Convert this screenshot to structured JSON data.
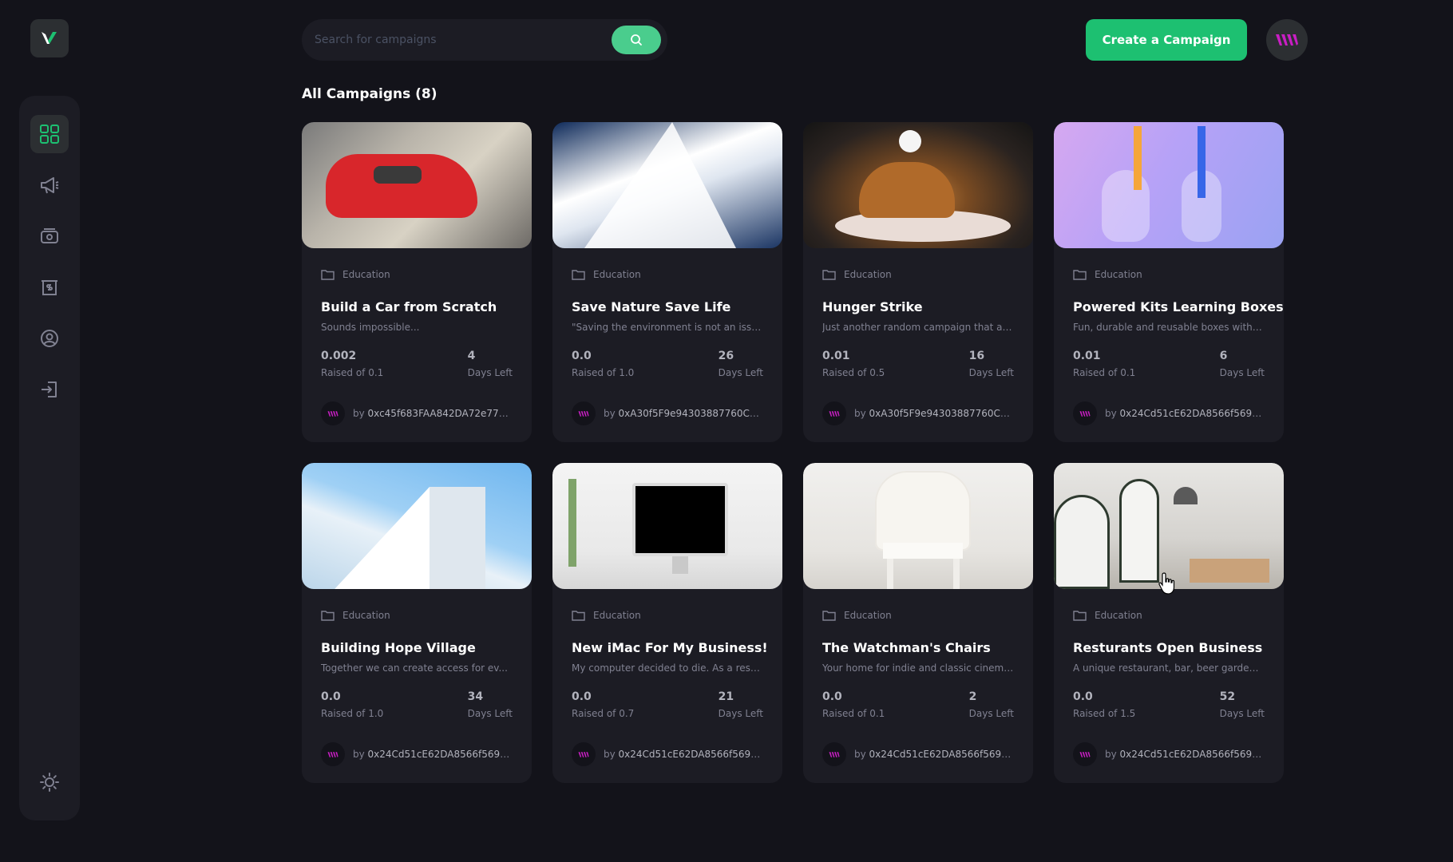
{
  "search": {
    "placeholder": "Search for campaigns"
  },
  "header": {
    "create_label": "Create a Campaign"
  },
  "section": {
    "title": "All Campaigns (8)"
  },
  "sidebar": {
    "items": [
      {
        "icon": "dashboard-icon",
        "active": true
      },
      {
        "icon": "campaign-icon",
        "active": false
      },
      {
        "icon": "payment-icon",
        "active": false
      },
      {
        "icon": "withdraw-icon",
        "active": false
      },
      {
        "icon": "profile-icon",
        "active": false
      },
      {
        "icon": "logout-icon",
        "active": false
      }
    ],
    "theme_icon": "sun-icon"
  },
  "colors": {
    "accent": "#1dc071",
    "search_button": "#4acd8d",
    "card_bg": "#1c1c24",
    "page_bg": "#13131a"
  },
  "campaigns": [
    {
      "category": "Education",
      "title": "Build a Car from Scratch",
      "description": "Sounds impossible...",
      "raised": "0.002",
      "raised_label": "Raised of 0.1",
      "days": "4",
      "days_label": "Days Left",
      "by": "by",
      "owner": "0xc45f683FAA842DA72e77A9B..."
    },
    {
      "category": "Education",
      "title": "Save Nature Save Life",
      "description": "\"Saving the environment is not an issue...",
      "raised": "0.0",
      "raised_label": "Raised of 1.0",
      "days": "26",
      "days_label": "Days Left",
      "by": "by",
      "owner": "0xA30f5F9e94303887760C2b1..."
    },
    {
      "category": "Education",
      "title": "Hunger Strike",
      "description": "Just another random campaign that ai...",
      "raised": "0.01",
      "raised_label": "Raised of 0.5",
      "days": "16",
      "days_label": "Days Left",
      "by": "by",
      "owner": "0xA30f5F9e94303887760C2b1..."
    },
    {
      "category": "Education",
      "title": "Powered Kits Learning Boxes",
      "description": "Fun, durable and reusable boxes with e...",
      "raised": "0.01",
      "raised_label": "Raised of 0.1",
      "days": "6",
      "days_label": "Days Left",
      "by": "by",
      "owner": "0x24Cd51cE62DA8566f569261..."
    },
    {
      "category": "Education",
      "title": "Building Hope Village",
      "description": "Together we can create access for ev...",
      "raised": "0.0",
      "raised_label": "Raised of 1.0",
      "days": "34",
      "days_label": "Days Left",
      "by": "by",
      "owner": "0x24Cd51cE62DA8566f569261..."
    },
    {
      "category": "Education",
      "title": "New iMac For My Business!",
      "description": "My computer decided to die. As a resul...",
      "raised": "0.0",
      "raised_label": "Raised of 0.7",
      "days": "21",
      "days_label": "Days Left",
      "by": "by",
      "owner": "0x24Cd51cE62DA8566f569261..."
    },
    {
      "category": "Education",
      "title": "The Watchman's Chairs",
      "description": "Your home for indie and classic cinema...",
      "raised": "0.0",
      "raised_label": "Raised of 0.1",
      "days": "2",
      "days_label": "Days Left",
      "by": "by",
      "owner": "0x24Cd51cE62DA8566f569261..."
    },
    {
      "category": "Education",
      "title": "Resturants Open Business",
      "description": "A unique restaurant, bar, beer garden, ...",
      "raised": "0.0",
      "raised_label": "Raised of 1.5",
      "days": "52",
      "days_label": "Days Left",
      "by": "by",
      "owner": "0x24Cd51cE62DA8566f569261..."
    }
  ]
}
